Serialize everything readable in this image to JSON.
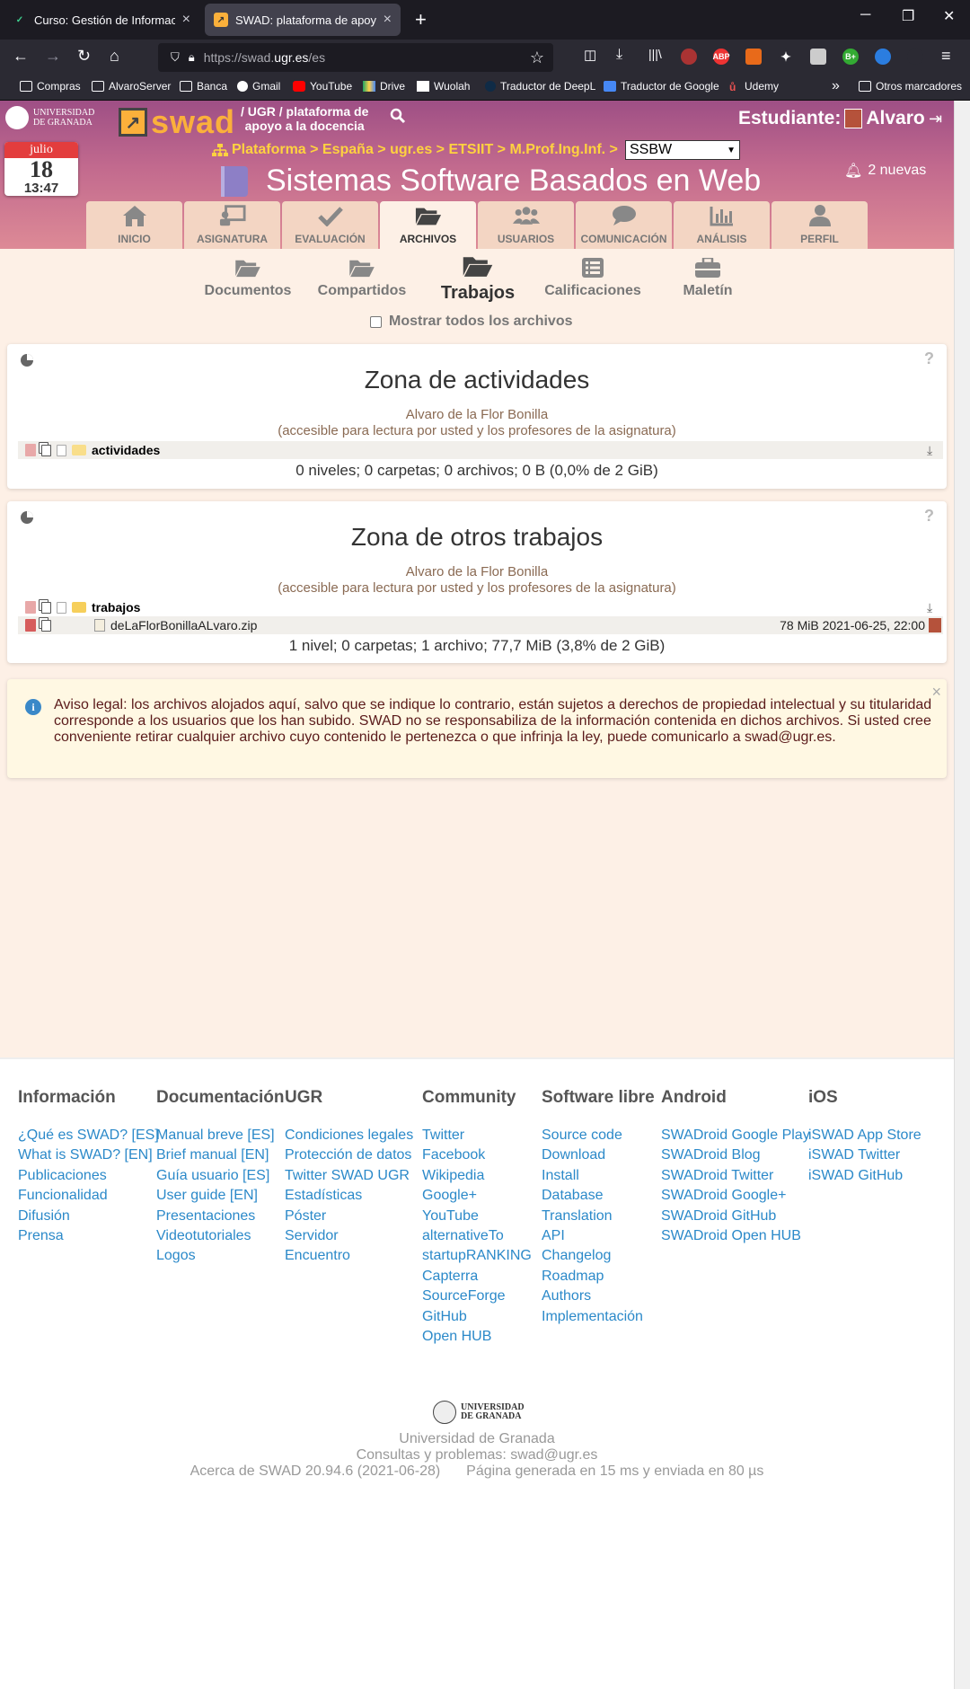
{
  "browser": {
    "tabs": [
      {
        "title": "Curso: Gestión de Información e",
        "close": "×"
      },
      {
        "title": "SWAD: plataforma de apoyo a la",
        "close": "×"
      }
    ],
    "new_tab": "+",
    "url_prefix": "https://swad.",
    "url_host": "ugr.es",
    "url_suffix": "/es",
    "bookmarks": [
      "Compras",
      "AlvaroServer",
      "Banca",
      "Gmail",
      "YouTube",
      "Drive",
      "Wuolah",
      "Traductor de DeepL",
      "Traductor de Google",
      "Udemy"
    ],
    "more_bookmarks": "»",
    "other_bookmarks": "Otros marcadores",
    "ext_abp": "ABP",
    "ext_b": "B+"
  },
  "header": {
    "ugr_line1": "UNIVERSIDAD",
    "ugr_line2": "DE GRANADA",
    "swad_word": "swad",
    "tagline1": "/ UGR / plataforma de",
    "tagline2": "apoyo a la docencia",
    "student_label": "Estudiante:",
    "student_name": "Alvaro",
    "calendar": {
      "month": "julio",
      "day": "18",
      "time": "13:47"
    },
    "breadcrumb": "Plataforma > España > ugr.es > ETSIIT > M.Prof.Ing.Inf. >",
    "course_select": "SSBW",
    "course_title": "Sistemas Software Basados en Web",
    "notifications": "2 nuevas"
  },
  "menu_tabs": [
    {
      "label": "INICIO",
      "icon": "home-icon"
    },
    {
      "label": "ASIGNATURA",
      "icon": "chalkboard-icon"
    },
    {
      "label": "EVALUACIÓN",
      "icon": "check-icon"
    },
    {
      "label": "ARCHIVOS",
      "icon": "folder-open-icon"
    },
    {
      "label": "USUARIOS",
      "icon": "users-icon"
    },
    {
      "label": "COMUNICACIÓN",
      "icon": "comment-icon"
    },
    {
      "label": "ANÁLISIS",
      "icon": "chart-icon"
    },
    {
      "label": "PERFIL",
      "icon": "user-icon"
    }
  ],
  "sub_tabs": [
    {
      "label": "Documentos"
    },
    {
      "label": "Compartidos"
    },
    {
      "label": "Trabajos"
    },
    {
      "label": "Calificaciones"
    },
    {
      "label": "Maletín"
    }
  ],
  "show_all_label": "Mostrar todos los archivos",
  "zones": [
    {
      "title": "Zona de actividades",
      "owner": "Alvaro de la Flor Bonilla",
      "access": "(accesible para lectura por usted y los profesores de la asignatura)",
      "folder": "actividades",
      "summary": "0 niveles; 0 carpetas; 0 archivos; 0 B (0,0% de 2 GiB)",
      "help": "?"
    },
    {
      "title": "Zona de otros trabajos",
      "owner": "Alvaro de la Flor Bonilla",
      "access": "(accesible para lectura por usted y los profesores de la asignatura)",
      "folder": "trabajos",
      "file": {
        "name": "deLaFlorBonillaALvaro.zip",
        "meta": "78 MiB 2021-06-25, 22:00"
      },
      "summary": "1 nivel; 0 carpetas; 1 archivo; 77,7 MiB (3,8% de 2 GiB)",
      "help": "?"
    }
  ],
  "notice": {
    "icon": "i",
    "text": "Aviso legal: los archivos alojados aquí, salvo que se indique lo contrario, están sujetos a derechos de propiedad intelectual y su titularidad corresponde a los usuarios que los han subido. SWAD no se responsabiliza de la información contenida en dichos archivos. Si usted cree conveniente retirar cualquier archivo cuyo contenido le pertenezca o que infrinja la ley, puede comunicarlo a swad@ugr.es.",
    "close": "×"
  },
  "footer": {
    "columns": [
      {
        "title": "Información",
        "links": [
          "¿Qué es SWAD? [ES]",
          "What is SWAD? [EN]",
          "Publicaciones",
          "Funcionalidad",
          "Difusión",
          "Prensa"
        ]
      },
      {
        "title": "Documentación",
        "links": [
          "Manual breve [ES]",
          "Brief manual [EN]",
          "Guía usuario [ES]",
          "User guide [EN]",
          "Presentaciones",
          "Videotutoriales",
          "Logos"
        ]
      },
      {
        "title": "UGR",
        "links": [
          "Condiciones legales",
          "Protección de datos",
          "Twitter SWAD UGR",
          "Estadísticas",
          "Póster",
          "Servidor",
          "Encuentro"
        ]
      },
      {
        "title": "Community",
        "links": [
          "Twitter",
          "Facebook",
          "Wikipedia",
          "Google+",
          "YouTube",
          "alternativeTo",
          "startupRANKING",
          "Capterra",
          "SourceForge",
          "GitHub",
          "Open HUB"
        ]
      },
      {
        "title": "Software libre",
        "links": [
          "Source code",
          "Download",
          "Install",
          "Database",
          "Translation",
          "API",
          "Changelog",
          "Roadmap",
          "Authors",
          "Implementación"
        ]
      },
      {
        "title": "Android",
        "links": [
          "SWADroid Google Play",
          "SWADroid Blog",
          "SWADroid Twitter",
          "SWADroid Google+",
          "SWADroid GitHub",
          "SWADroid Open HUB"
        ]
      },
      {
        "title": "iOS",
        "links": [
          "iSWAD App Store",
          "iSWAD Twitter",
          "iSWAD GitHub"
        ]
      }
    ],
    "ugr_line1": "UNIVERSIDAD",
    "ugr_line2": "DE GRANADA",
    "university": "Universidad de Granada",
    "contact": "Consultas y problemas: swad@ugr.es",
    "about": "Acerca de SWAD 20.94.6 (2021-06-28)",
    "timing": "Página generada en 15 ms y enviada en 80 µs"
  }
}
